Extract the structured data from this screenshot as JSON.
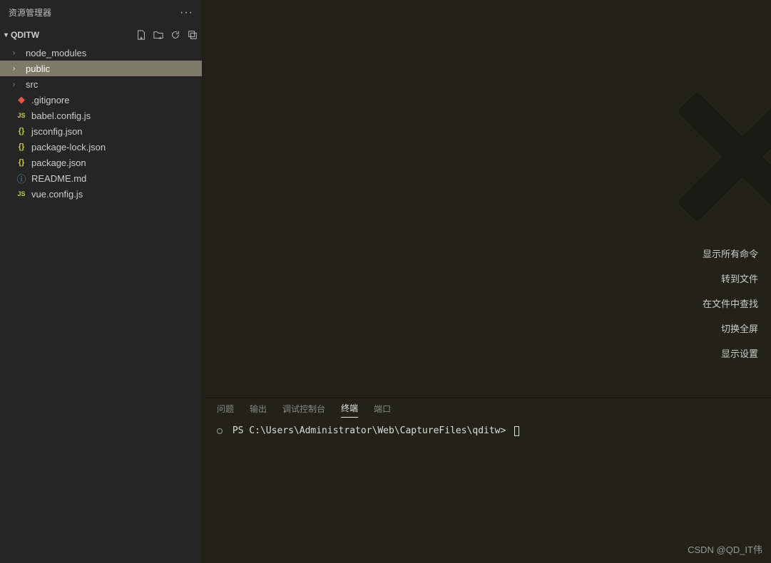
{
  "sidebar": {
    "title": "资源管理器",
    "project": "QDITW",
    "tree": {
      "folders": [
        {
          "label": "node_modules",
          "expanded": false
        },
        {
          "label": "public",
          "expanded": false,
          "selected": true
        },
        {
          "label": "src",
          "expanded": false
        }
      ],
      "files": [
        {
          "label": ".gitignore",
          "icon": "git"
        },
        {
          "label": "babel.config.js",
          "icon": "js"
        },
        {
          "label": "jsconfig.json",
          "icon": "json"
        },
        {
          "label": "package-lock.json",
          "icon": "json"
        },
        {
          "label": "package.json",
          "icon": "json"
        },
        {
          "label": "README.md",
          "icon": "info"
        },
        {
          "label": "vue.config.js",
          "icon": "js"
        }
      ]
    }
  },
  "commands": [
    "显示所有命令",
    "转到文件",
    "在文件中查找",
    "切换全屏",
    "显示设置"
  ],
  "panel": {
    "tabs": [
      {
        "label": "问题",
        "active": false
      },
      {
        "label": "输出",
        "active": false
      },
      {
        "label": "调试控制台",
        "active": false
      },
      {
        "label": "终端",
        "active": true
      },
      {
        "label": "端口",
        "active": false
      }
    ],
    "terminal_prompt": "PS C:\\Users\\Administrator\\Web\\CaptureFiles\\qditw>"
  },
  "watermark": "CSDN @QD_IT伟"
}
